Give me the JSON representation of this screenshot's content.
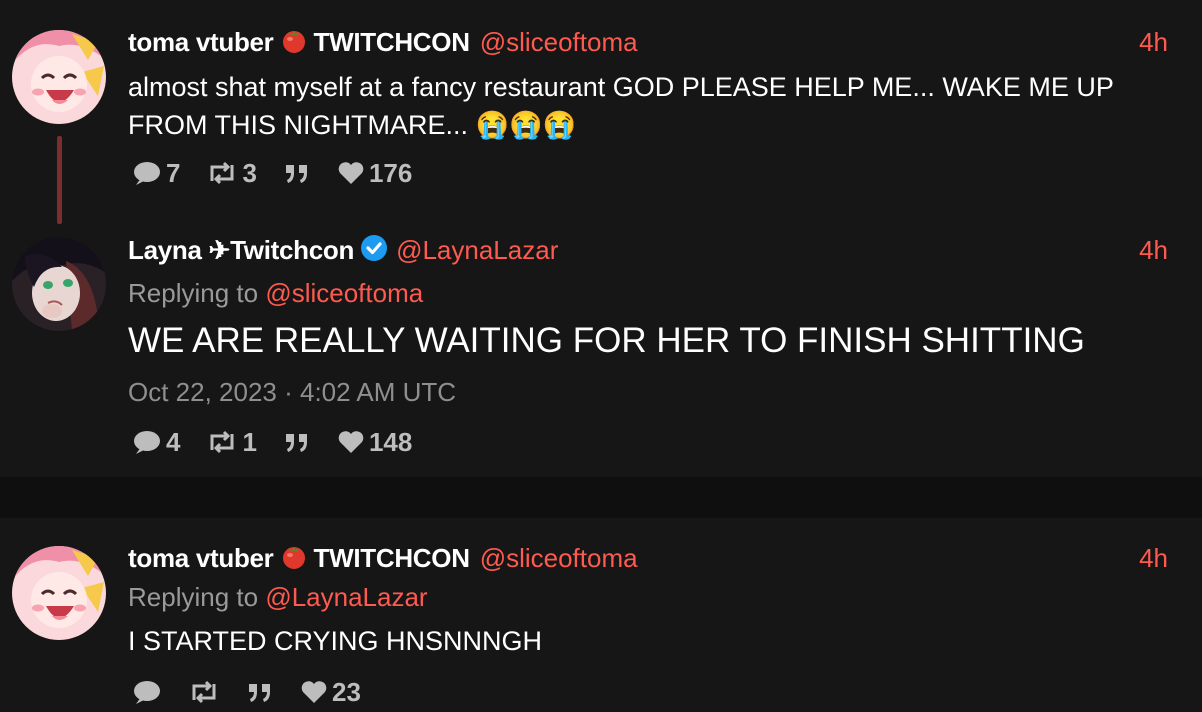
{
  "tweets": [
    {
      "author_name": "toma vtuber",
      "author_suffix": "TWITCHCON",
      "handle": "@sliceoftoma",
      "time": "4h",
      "text": "almost shat myself at a fancy restaurant GOD PLEASE HELP ME... WAKE ME UP FROM THIS NIGHTMARE... 😭😭😭",
      "stats": {
        "replies": "7",
        "retweets": "3",
        "likes": "176"
      }
    },
    {
      "author_name": "Layna",
      "author_suffix": "✈Twitchcon",
      "handle": "@LaynaLazar",
      "time": "4h",
      "replying_prefix": "Replying to",
      "replying_to": "@sliceoftoma",
      "text": "WE ARE REALLY WAITING FOR HER TO FINISH SHITTING",
      "date": "Oct 22, 2023 · 4:02 AM UTC",
      "stats": {
        "replies": "4",
        "retweets": "1",
        "likes": "148"
      }
    },
    {
      "author_name": "toma vtuber",
      "author_suffix": "TWITCHCON",
      "handle": "@sliceoftoma",
      "time": "4h",
      "replying_prefix": "Replying to",
      "replying_to": "@LaynaLazar",
      "text": "I STARTED CRYING HNSNNNGH",
      "stats": {
        "likes": "23"
      }
    }
  ],
  "icons": [
    "tomato-icon",
    "verified-icon",
    "reply-icon",
    "retweet-icon",
    "quote-icon",
    "heart-icon"
  ],
  "colors": {
    "accent": "#ff5a4f",
    "background": "#161616",
    "muted": "#9a9a9a",
    "verified": "#1d9bf0"
  }
}
